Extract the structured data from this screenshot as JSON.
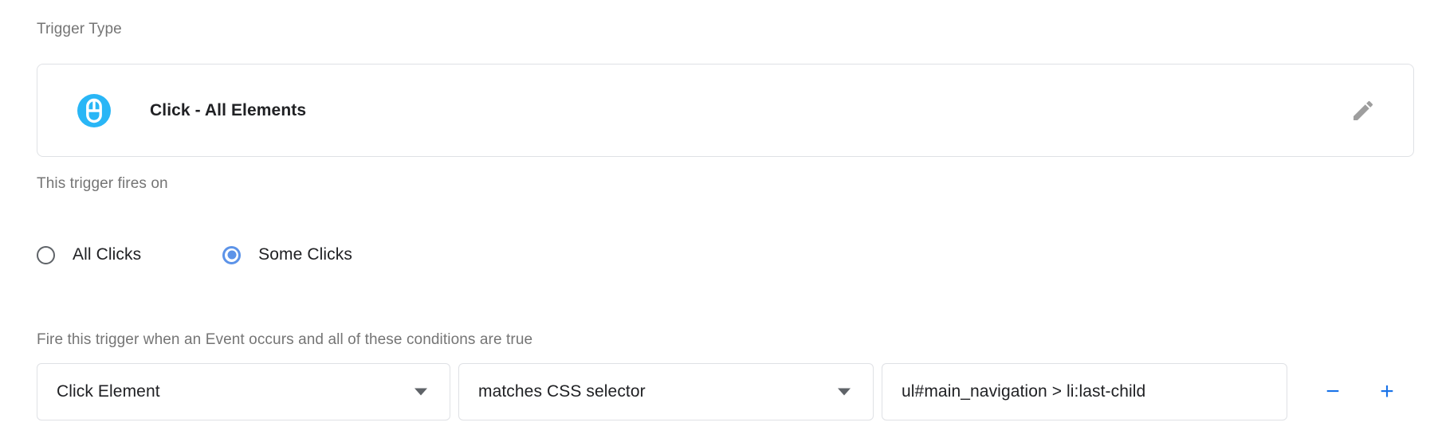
{
  "trigger_type": {
    "label": "Trigger Type",
    "name": "Click - All Elements",
    "icon": "mouse-click-icon",
    "icon_color": "#29B6F6",
    "edit_icon": "pencil-icon",
    "edit_icon_color": "#9e9e9e"
  },
  "fires_on": {
    "label": "This trigger fires on",
    "options": [
      {
        "label": "All Clicks",
        "selected": false
      },
      {
        "label": "Some Clicks",
        "selected": true
      }
    ],
    "selected_color": "#5C93E8",
    "unselected_color": "#5F6368"
  },
  "conditions": {
    "label": "Fire this trigger when an Event occurs and all of these conditions are true",
    "row": {
      "variable": "Click Element",
      "operator": "matches CSS selector",
      "value": "ul#main_navigation > li:last-child",
      "value_placeholder": ""
    },
    "remove_label": "−",
    "add_label": "+",
    "button_color": "#1A73E8"
  }
}
